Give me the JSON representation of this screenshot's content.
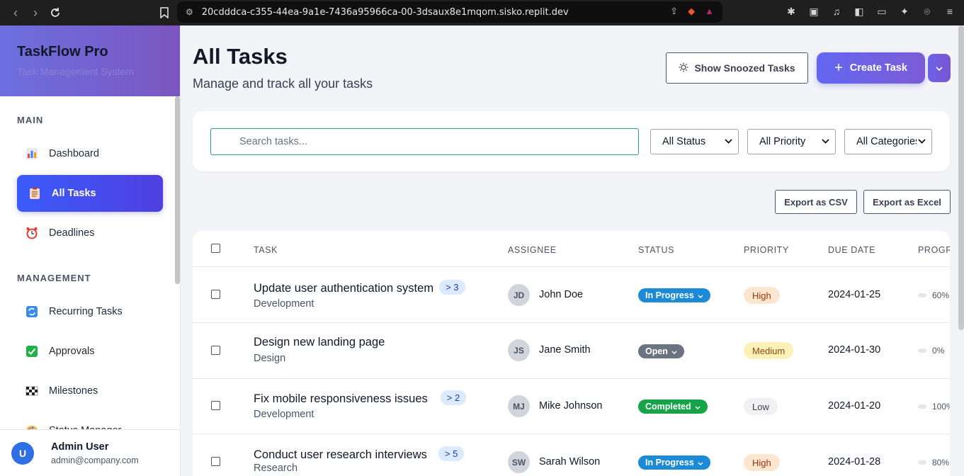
{
  "browser": {
    "url": "20cdddca-c355-44ea-9a1e-7436a95966ca-00-3dsaux8e1mqom.sisko.replit.dev"
  },
  "sidebar": {
    "app_name": "TaskFlow Pro",
    "app_tagline": "Task Management System",
    "sections": [
      {
        "heading": "MAIN",
        "items": [
          {
            "label": "Dashboard",
            "icon": "bar-chart-icon",
            "active": false
          },
          {
            "label": "All Tasks",
            "icon": "clipboard-icon",
            "active": true
          },
          {
            "label": "Deadlines",
            "icon": "alarm-clock-icon",
            "active": false
          }
        ]
      },
      {
        "heading": "MANAGEMENT",
        "items": [
          {
            "label": "Recurring Tasks",
            "icon": "repeat-icon",
            "active": false
          },
          {
            "label": "Approvals",
            "icon": "check-box-icon",
            "active": false
          },
          {
            "label": "Milestones",
            "icon": "checkered-flag-icon",
            "active": false
          },
          {
            "label": "Status Manager",
            "icon": "palette-icon",
            "active": false
          }
        ]
      }
    ],
    "user": {
      "initial": "U",
      "name": "Admin User",
      "email": "admin@company.com"
    }
  },
  "header": {
    "title": "All Tasks",
    "subtitle": "Manage and track all your tasks",
    "snoozed_label": "Show Snoozed Tasks",
    "create_label": "Create Task"
  },
  "filters": {
    "search_placeholder": "Search tasks...",
    "status": "All Status",
    "priority": "All Priority",
    "category": "All Categories"
  },
  "export": {
    "csv_label": "Export as CSV",
    "excel_label": "Export as Excel"
  },
  "table": {
    "columns": [
      "TASK",
      "ASSIGNEE",
      "STATUS",
      "PRIORITY",
      "DUE DATE",
      "PROGRESS"
    ],
    "rows": [
      {
        "title": "Update user authentication system",
        "subtasks": "> 3",
        "category": "Development",
        "initials": "JD",
        "assignee": "John Doe",
        "status": "In Progress",
        "priority": "High",
        "due": "2024-01-25",
        "progress": "60%"
      },
      {
        "title": "Design new landing page",
        "subtasks": "",
        "category": "Design",
        "initials": "JS",
        "assignee": "Jane Smith",
        "status": "Open",
        "priority": "Medium",
        "due": "2024-01-30",
        "progress": "0%"
      },
      {
        "title": "Fix mobile responsiveness issues",
        "subtasks": "> 2",
        "category": "Development",
        "initials": "MJ",
        "assignee": "Mike Johnson",
        "status": "Completed",
        "priority": "Low",
        "due": "2024-01-20",
        "progress": "100%"
      },
      {
        "title": "Conduct user research interviews",
        "subtasks": "> 5",
        "category": "Research",
        "initials": "SW",
        "assignee": "Sarah Wilson",
        "status": "In Progress",
        "priority": "High",
        "due": "2024-01-28",
        "progress": "80%"
      }
    ]
  },
  "colors": {
    "accent": "#6366f1",
    "status_in_progress": "#1d8ad8",
    "status_open": "#6b7280",
    "status_completed": "#16a34a",
    "priority_high_bg": "#fde6cf",
    "priority_medium_bg": "#fdf1b8",
    "priority_low_bg": "#f1f1f3"
  }
}
